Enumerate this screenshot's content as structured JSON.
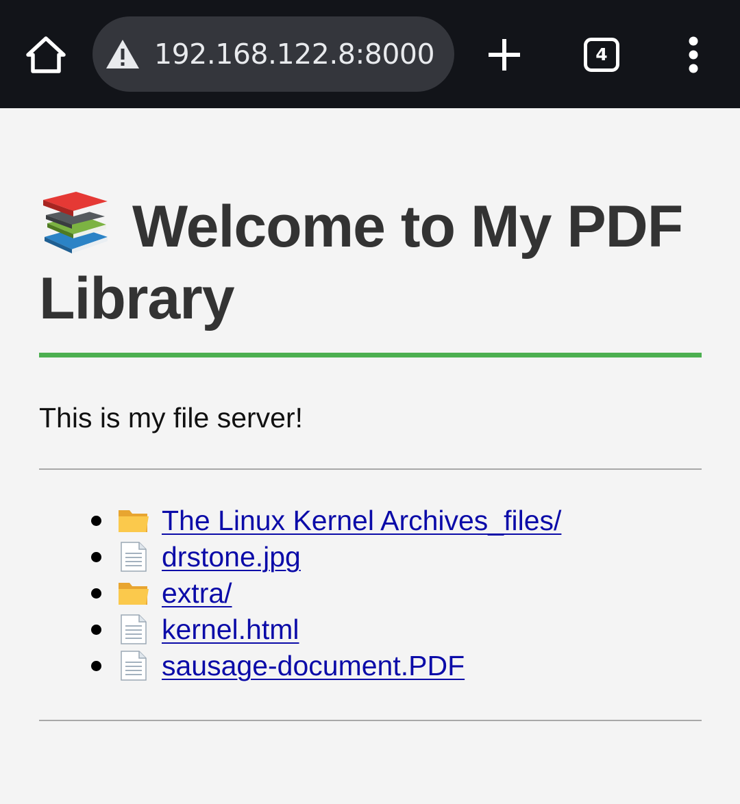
{
  "browser": {
    "url": "192.168.122.8:8000",
    "tab_count": "4",
    "icons": {
      "home": "home-icon",
      "security": "warning-icon",
      "new_tab": "plus-icon",
      "tabs": "tab-switcher-icon",
      "menu": "more-vert-icon"
    }
  },
  "page": {
    "title": "Welcome to My PDF Library",
    "title_emoji": "books-icon",
    "intro": "This is my file server!",
    "accent_color": "#4caf50",
    "link_color": "#0b0ba8",
    "files": [
      {
        "name": "The Linux Kernel Archives_files/",
        "type": "folder"
      },
      {
        "name": "drstone.jpg",
        "type": "file"
      },
      {
        "name": "extra/",
        "type": "folder"
      },
      {
        "name": "kernel.html",
        "type": "file"
      },
      {
        "name": "sausage-document.PDF",
        "type": "file"
      }
    ]
  }
}
